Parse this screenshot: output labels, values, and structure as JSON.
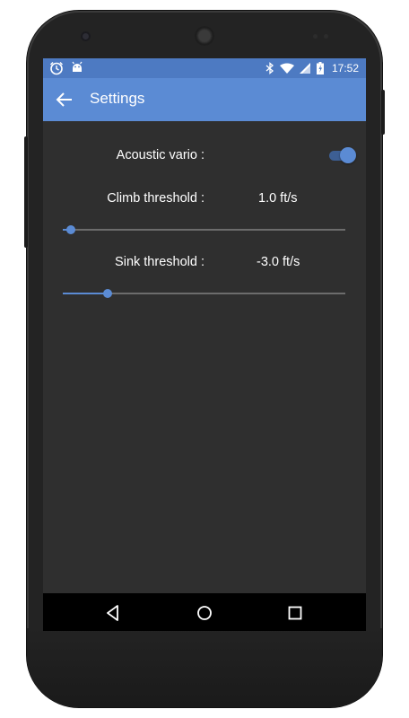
{
  "statusbar": {
    "time": "17:52",
    "icons": [
      "alarm-clock-icon",
      "android-icon",
      "bluetooth-icon",
      "wifi-icon",
      "signal-icon",
      "battery-charging-icon"
    ]
  },
  "appbar": {
    "title": "Settings",
    "back_icon": "back-arrow-icon"
  },
  "settings": {
    "acoustic_vario": {
      "label": "Acoustic vario :",
      "enabled": true
    },
    "climb_threshold": {
      "label": "Climb threshold :",
      "value": "1.0 ft/s",
      "slider_fraction": 0.03
    },
    "sink_threshold": {
      "label": "Sink threshold :",
      "value": "-3.0 ft/s",
      "slider_fraction": 0.16
    }
  },
  "navbar": {
    "buttons": [
      "back-triangle-icon",
      "home-circle-icon",
      "recents-square-icon"
    ]
  },
  "colors": {
    "status_bar": "#4d7ac2",
    "app_bar": "#5b8bd4",
    "accent": "#5b8bd4",
    "background": "#2f2f2f"
  }
}
